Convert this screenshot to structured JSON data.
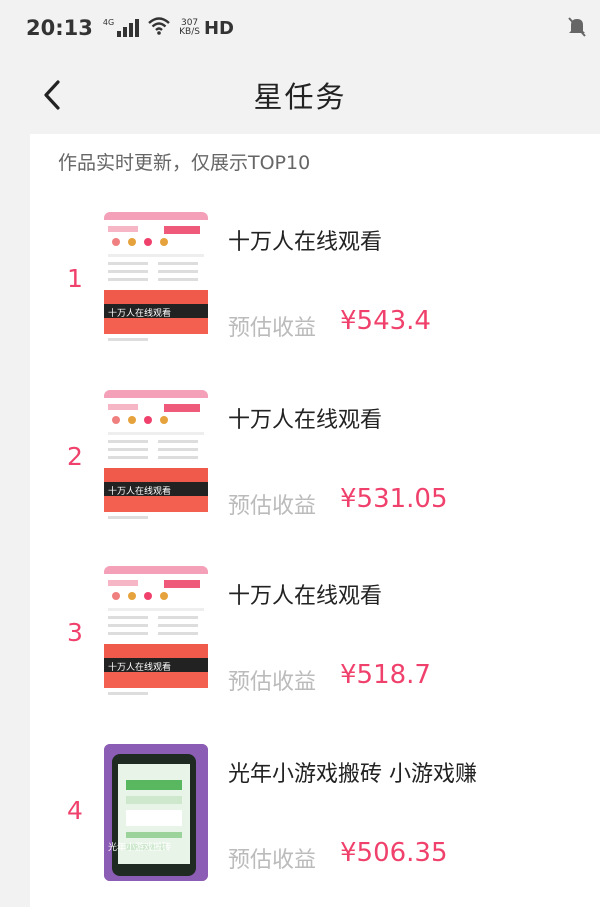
{
  "status_bar": {
    "time": "20:13",
    "net_type": "4G",
    "speed_value": "307",
    "speed_unit": "KB/S",
    "hd": "HD"
  },
  "nav": {
    "title": "星任务"
  },
  "list": {
    "subtitle": "作品实时更新，仅展示TOP10",
    "earnings_label": "预估收益",
    "items": [
      {
        "rank": "1",
        "title": "十万人在线观看",
        "amount": "¥543.4",
        "thumb_caption": "十万人在线观看"
      },
      {
        "rank": "2",
        "title": "十万人在线观看",
        "amount": "¥531.05",
        "thumb_caption": "十万人在线观看"
      },
      {
        "rank": "3",
        "title": "十万人在线观看",
        "amount": "¥518.7",
        "thumb_caption": "十万人在线观看"
      },
      {
        "rank": "4",
        "title": "光年小游戏搬砖 小游戏赚",
        "amount": "¥506.35",
        "thumb_caption": "光年小游戏搬砖"
      }
    ]
  },
  "colors": {
    "accent": "#f0416c",
    "background": "#f2f2f2",
    "card": "#ffffff",
    "game_thumb": "#8c5db4"
  },
  "icons": [
    "signal-icon",
    "wifi-icon",
    "mute-icon",
    "back-arrow-icon"
  ]
}
